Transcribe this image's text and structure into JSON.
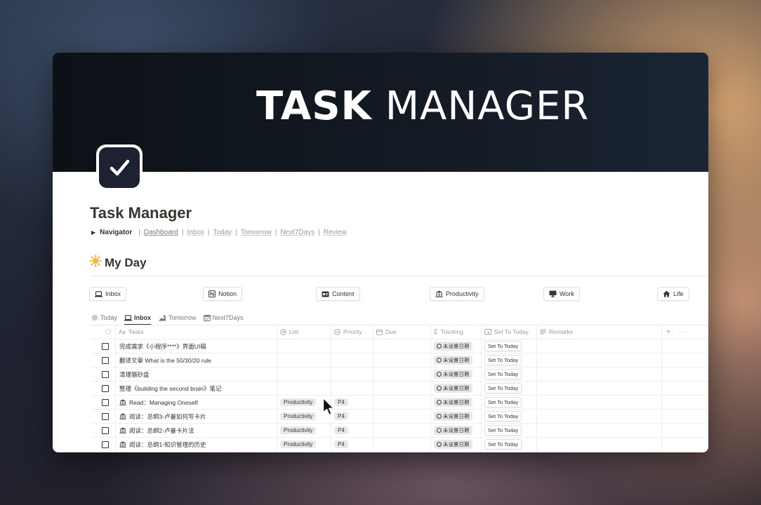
{
  "cover": {
    "title_bold": "TASK",
    "title_light": "MANAGER"
  },
  "page": {
    "title": "Task Manager"
  },
  "navigator": {
    "label": "Navigator",
    "links": [
      "Dashboard",
      "Inbox",
      "Today",
      "Tomorrow",
      "Next7Days",
      "Review"
    ]
  },
  "section": {
    "heading": "My Day",
    "icon": "sun-emoji-icon"
  },
  "quick_buttons": [
    {
      "label": "Inbox",
      "icon": "laptop-icon"
    },
    {
      "label": "Notion",
      "icon": "notion-icon"
    },
    {
      "label": "Content",
      "icon": "card-icon"
    },
    {
      "label": "Productivity",
      "icon": "building-icon"
    },
    {
      "label": "Work",
      "icon": "monitor-icon"
    },
    {
      "label": "Life",
      "icon": "house-icon"
    }
  ],
  "views": [
    {
      "label": "Today",
      "icon": "sun-icon",
      "active": false
    },
    {
      "label": "Inbox",
      "icon": "laptop-icon",
      "active": true
    },
    {
      "label": "Tomorrow",
      "icon": "sunrise-icon",
      "active": false
    },
    {
      "label": "Next7Days",
      "icon": "calendar-icon",
      "active": false
    }
  ],
  "table": {
    "columns": {
      "tasks": "Tasks",
      "list": "List",
      "priority": "Priority",
      "due": "Due",
      "tracking": "Tracking",
      "set_to_today": "Set To Today",
      "remarks": "Remarks"
    },
    "rows": [
      {
        "task": "完成需求《小程序****》界面UI稿",
        "has_icon": false,
        "list": "",
        "priority": "",
        "tracking": "未设置日期",
        "button": "Set To Today"
      },
      {
        "task": "翻译文章 What is the 50/30/20 rule",
        "has_icon": false,
        "list": "",
        "priority": "",
        "tracking": "未设置日期",
        "button": "Set To Today"
      },
      {
        "task": "清理猫砂盘",
        "has_icon": false,
        "list": "",
        "priority": "",
        "tracking": "未设置日期",
        "button": "Set To Today"
      },
      {
        "task": "整理《building the second brain》笔记",
        "has_icon": false,
        "list": "",
        "priority": "",
        "tracking": "未设置日期",
        "button": "Set To Today"
      },
      {
        "task": "Read：Managing Oneself",
        "has_icon": true,
        "list": "Productivity",
        "priority": "P4",
        "tracking": "未设置日期",
        "button": "Set To Today"
      },
      {
        "task": "阅读：总纲3-卢曼如何写卡片",
        "has_icon": true,
        "list": "Productivity",
        "priority": "P4",
        "tracking": "未设置日期",
        "button": "Set To Today"
      },
      {
        "task": "阅读：总纲2-卢曼卡片法",
        "has_icon": true,
        "list": "Productivity",
        "priority": "P4",
        "tracking": "未设置日期",
        "button": "Set To Today"
      },
      {
        "task": "阅读：总纲1-知识管理的历史",
        "has_icon": true,
        "list": "Productivity",
        "priority": "P4",
        "tracking": "未设置日期",
        "button": "Set To Today"
      }
    ]
  }
}
